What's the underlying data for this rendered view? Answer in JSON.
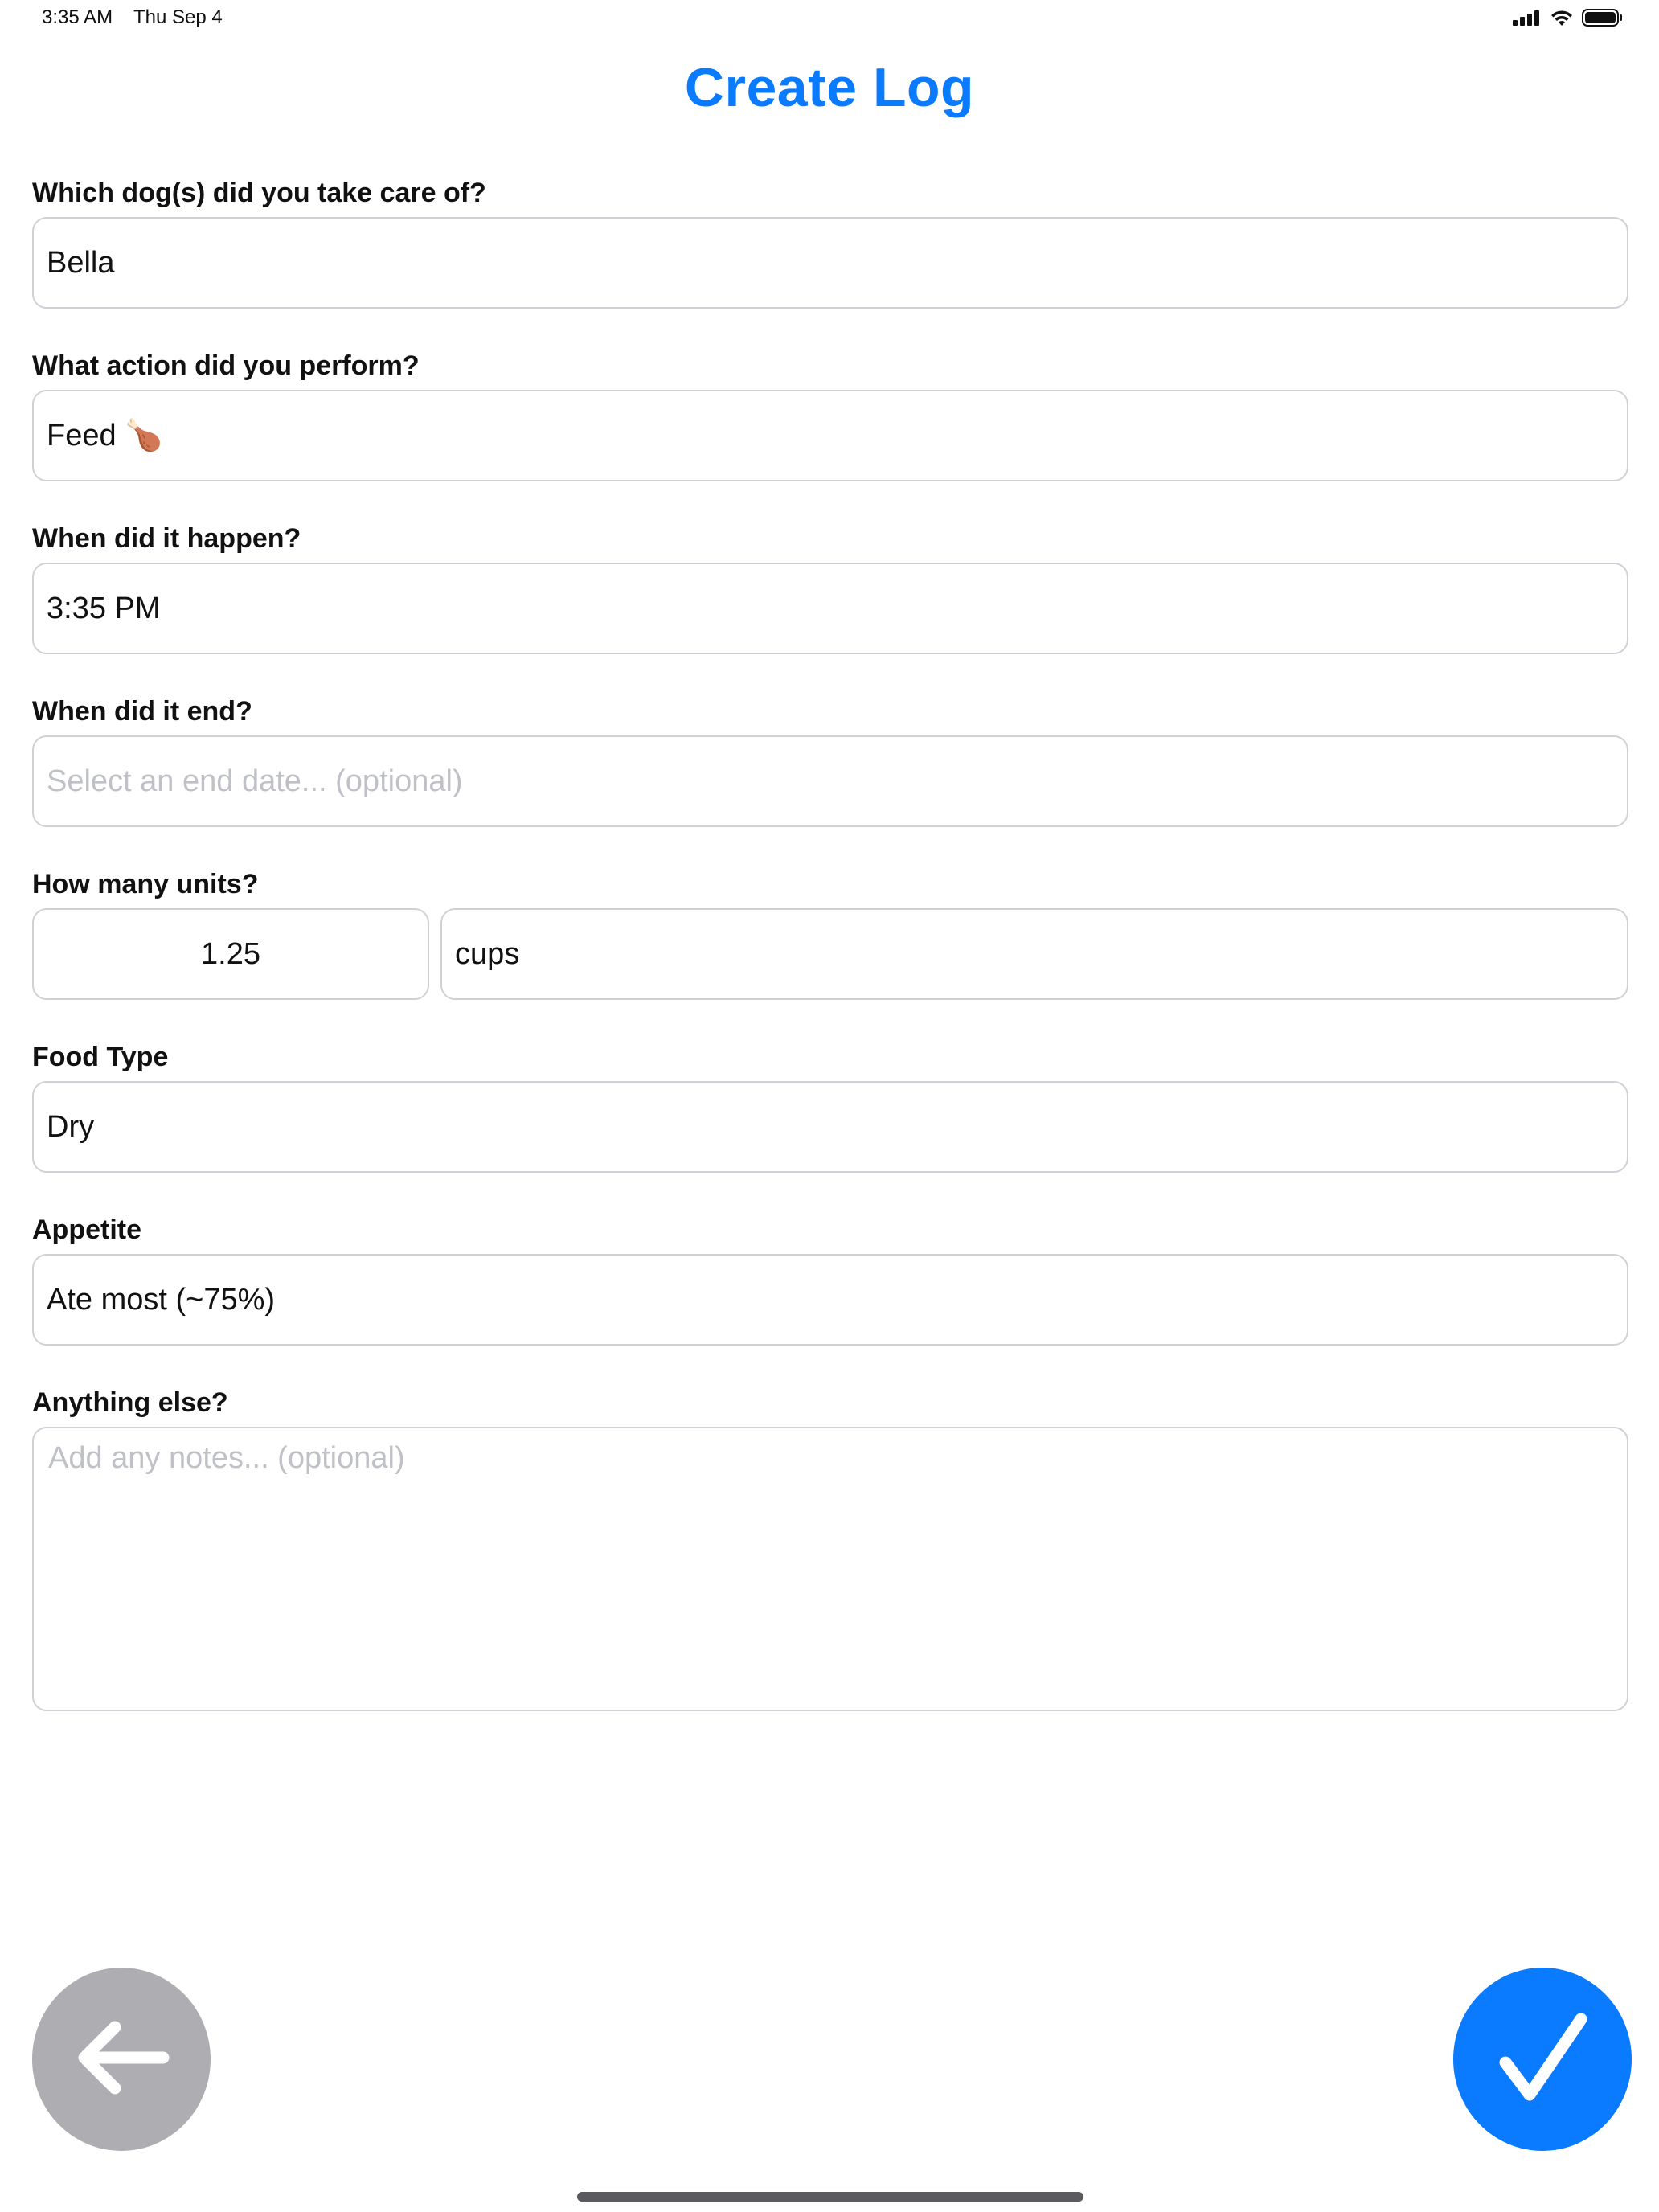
{
  "status_bar": {
    "time": "3:35 AM",
    "date": "Thu Sep 4",
    "icons": [
      "cellular-signal-icon",
      "wifi-icon",
      "battery-icon"
    ]
  },
  "page": {
    "title": "Create Log"
  },
  "form": {
    "dogs": {
      "label": "Which dog(s) did you take care of?",
      "value": "Bella"
    },
    "action": {
      "label": "What action did you perform?",
      "value": "Feed 🍗"
    },
    "start": {
      "label": "When did it happen?",
      "value": "3:35 PM"
    },
    "end": {
      "label": "When did it end?",
      "placeholder": "Select an end date... (optional)"
    },
    "units": {
      "label": "How many units?",
      "count": "1.25",
      "unit": "cups"
    },
    "food_type": {
      "label": "Food Type",
      "value": "Dry"
    },
    "appetite": {
      "label": "Appetite",
      "value": "Ate most (~75%)"
    },
    "notes": {
      "label": "Anything else?",
      "placeholder": "Add any notes... (optional)"
    }
  },
  "buttons": {
    "back_icon": "arrow-left-icon",
    "confirm_icon": "checkmark-icon"
  },
  "colors": {
    "accent": "#0a7aff",
    "back_button": "#aeaeb2",
    "field_border": "#cfd1d6",
    "placeholder": "#bfc1c6"
  }
}
